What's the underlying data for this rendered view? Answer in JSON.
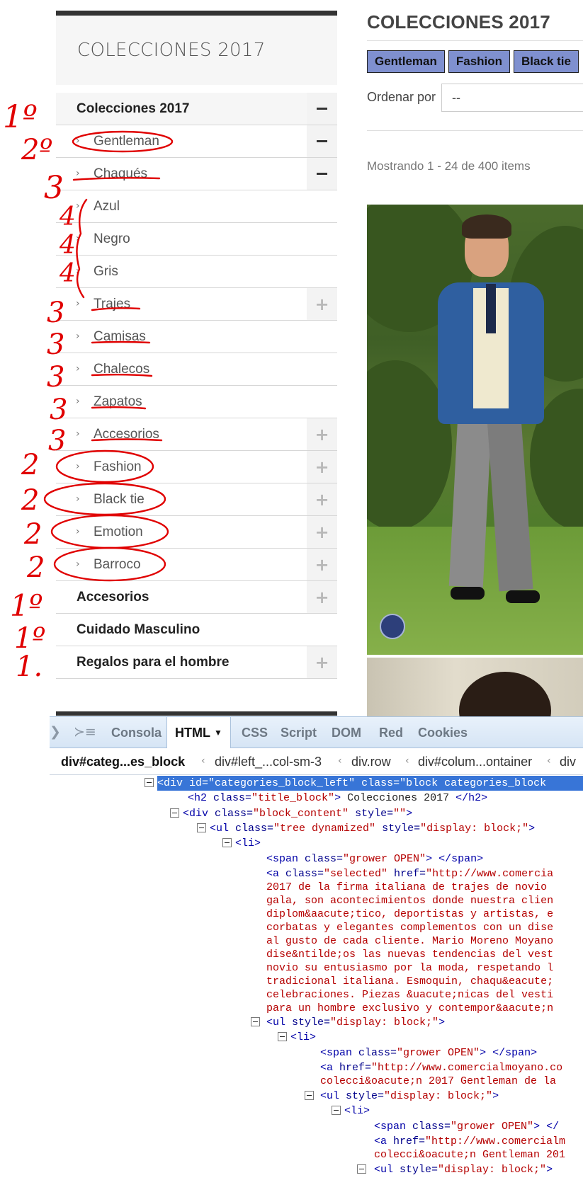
{
  "sidebar": {
    "title": "COLECCIONES 2017",
    "items": [
      {
        "label": "Colecciones 2017",
        "level": 1,
        "toggle": "minus"
      },
      {
        "label": "Gentleman",
        "level": 2,
        "toggle": "minus"
      },
      {
        "label": "Chaqués",
        "level": 3,
        "toggle": "minus"
      },
      {
        "label": "Azul",
        "level": 4,
        "toggle": ""
      },
      {
        "label": "Negro",
        "level": 4,
        "toggle": ""
      },
      {
        "label": "Gris",
        "level": 4,
        "toggle": ""
      },
      {
        "label": "Trajes",
        "level": 3,
        "toggle": "plus"
      },
      {
        "label": "Camisas",
        "level": 3,
        "toggle": ""
      },
      {
        "label": "Chalecos",
        "level": 3,
        "toggle": ""
      },
      {
        "label": "Zapatos",
        "level": 3,
        "toggle": ""
      },
      {
        "label": "Accesorios",
        "level": 3,
        "toggle": "plus"
      },
      {
        "label": "Fashion",
        "level": 2,
        "toggle": "plus"
      },
      {
        "label": "Black tie",
        "level": 2,
        "toggle": "plus"
      },
      {
        "label": "Emotion",
        "level": 2,
        "toggle": "plus"
      },
      {
        "label": "Barroco",
        "level": 2,
        "toggle": "plus"
      },
      {
        "label": "Accesorios",
        "level": 1,
        "toggle": "plus"
      },
      {
        "label": "Cuidado Masculino",
        "level": 1,
        "toggle": ""
      },
      {
        "label": "Regalos para el hombre",
        "level": 1,
        "toggle": "plus"
      }
    ]
  },
  "main": {
    "title": "COLECCIONES 2017",
    "tabs": [
      "Gentleman",
      "Fashion",
      "Black tie"
    ],
    "sort_label": "Ordenar por",
    "sort_value": "--",
    "showing": "Mostrando 1 - 24 de 400 items"
  },
  "annotations": {
    "marks": [
      "1º",
      "2º",
      "3",
      "4",
      "4",
      "4",
      "3",
      "3",
      "3",
      "3",
      "3",
      "2",
      "2",
      "2",
      "2",
      "1º",
      "1º",
      "1."
    ]
  },
  "devtools": {
    "tabs": [
      "Consola",
      "HTML",
      "CSS",
      "Script",
      "DOM",
      "Red",
      "Cookies"
    ],
    "active_tab": "HTML",
    "breadcrumb": [
      "div#categ...es_block",
      "div#left_...col-sm-3",
      "div.row",
      "div#colum...ontainer",
      "div"
    ],
    "code": {
      "l1": {
        "open": "<div ",
        "id_attr": "id=",
        "id_val": "\"categories_block_left\"",
        "class_attr": " class=",
        "class_val": "\"block categories_block"
      },
      "l2": {
        "open": "<h2 ",
        "attr": "class=",
        "val": "\"title_block\"",
        "close": ">",
        "text": " Colecciones 2017 ",
        "end": "</h2>"
      },
      "l3": {
        "open": "<div ",
        "attr": "class=",
        "val": "\"block_content\"",
        "attr2": " style=",
        "val2": "\"\"",
        "close": ">"
      },
      "l4": {
        "open": "<ul ",
        "attr": "class=",
        "val": "\"tree dynamized\"",
        "attr2": " style=",
        "val2": "\"display: block;\"",
        "close": ">"
      },
      "l5": {
        "tag": "<li>"
      },
      "l6": {
        "open": "<span ",
        "attr": "class=",
        "val": "\"grower OPEN\"",
        "close": ">",
        "end": " </span>"
      },
      "l7": {
        "open": "<a ",
        "attr": "class=",
        "val": "\"selected\"",
        "attr2": " href=",
        "val2": "\"http://www.comercia"
      },
      "desc": [
        "2017 de la firma italiana de trajes de novio",
        "gala, son acontecimientos donde nuestra clien",
        "diplom&aacute;tico, deportistas y artistas, e",
        "corbatas y elegantes complementos con un dise",
        "al gusto de cada cliente. Mario Moreno Moyano",
        "dise&ntilde;os las nuevas tendencias del vest",
        "novio su entusiasmo por la moda, respetando l",
        "tradicional italiana. Esmoquin, chaqu&eacute;",
        "celebraciones. Piezas &uacute;nicas del vesti",
        "para un hombre exclusivo y contempor&aacute;n"
      ],
      "l18": {
        "open": "<ul ",
        "attr": "style=",
        "val": "\"display: block;\"",
        "close": ">"
      },
      "l19": {
        "tag": "<li>"
      },
      "l20": {
        "open": "<span ",
        "attr": "class=",
        "val": "\"grower OPEN\"",
        "close": ">",
        "end": " </span>"
      },
      "l21": {
        "open": "<a ",
        "attr": "href=",
        "val": "\"http://www.comercialmoyano.co"
      },
      "l22": {
        "text": "colecci&oacute;n 2017 Gentleman de la"
      },
      "l23": {
        "open": "<ul ",
        "attr": "style=",
        "val": "\"display: block;\"",
        "close": ">"
      },
      "l24": {
        "tag": "<li>"
      },
      "l25": {
        "open": "<span ",
        "attr": "class=",
        "val": "\"grower OPEN\"",
        "close": ">",
        "end": " </"
      },
      "l26": {
        "open": "<a ",
        "attr": "href=",
        "val": "\"http://www.comercialm"
      },
      "l27": {
        "text": "colecci&oacute;n Gentleman 201"
      },
      "l28": {
        "open": "<ul ",
        "attr": "style=",
        "val": "\"display: block;\"",
        "close": ">"
      }
    }
  },
  "colors": {
    "tab_bg": "#7f90cf",
    "annotation": "#e00000",
    "selection": "#3875d7",
    "code_tag": "#0000a8",
    "code_value": "#b50000"
  }
}
